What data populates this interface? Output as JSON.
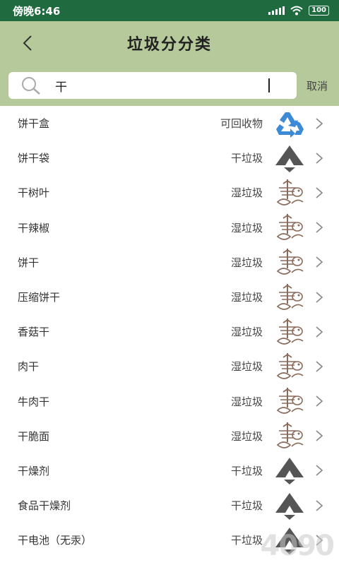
{
  "status_bar": {
    "time": "傍晚6:46",
    "battery": "100"
  },
  "header": {
    "title": "垃圾分分类"
  },
  "search": {
    "value": "干",
    "cancel_label": "取消"
  },
  "colors": {
    "status_bar": "#1f6b3f",
    "header": "#b6c99b",
    "recyclable": "#3d8ad6",
    "dry": "#555555",
    "wet": "#8a6a5a"
  },
  "items": [
    {
      "name": "饼干盒",
      "category": "可回收物",
      "icon": "recycle-icon"
    },
    {
      "name": "饼干袋",
      "category": "干垃圾",
      "icon": "dry-waste-icon"
    },
    {
      "name": "干树叶",
      "category": "湿垃圾",
      "icon": "wet-waste-icon"
    },
    {
      "name": "干辣椒",
      "category": "湿垃圾",
      "icon": "wet-waste-icon"
    },
    {
      "name": "饼干",
      "category": "湿垃圾",
      "icon": "wet-waste-icon"
    },
    {
      "name": "压缩饼干",
      "category": "湿垃圾",
      "icon": "wet-waste-icon"
    },
    {
      "name": "香菇干",
      "category": "湿垃圾",
      "icon": "wet-waste-icon"
    },
    {
      "name": "肉干",
      "category": "湿垃圾",
      "icon": "wet-waste-icon"
    },
    {
      "name": "牛肉干",
      "category": "湿垃圾",
      "icon": "wet-waste-icon"
    },
    {
      "name": "干脆面",
      "category": "湿垃圾",
      "icon": "wet-waste-icon"
    },
    {
      "name": "干燥剂",
      "category": "干垃圾",
      "icon": "dry-waste-icon"
    },
    {
      "name": "食品干燥剂",
      "category": "干垃圾",
      "icon": "dry-waste-icon"
    },
    {
      "name": "干电池（无汞）",
      "category": "干垃圾",
      "icon": "dry-waste-icon"
    }
  ],
  "watermark": "4090"
}
